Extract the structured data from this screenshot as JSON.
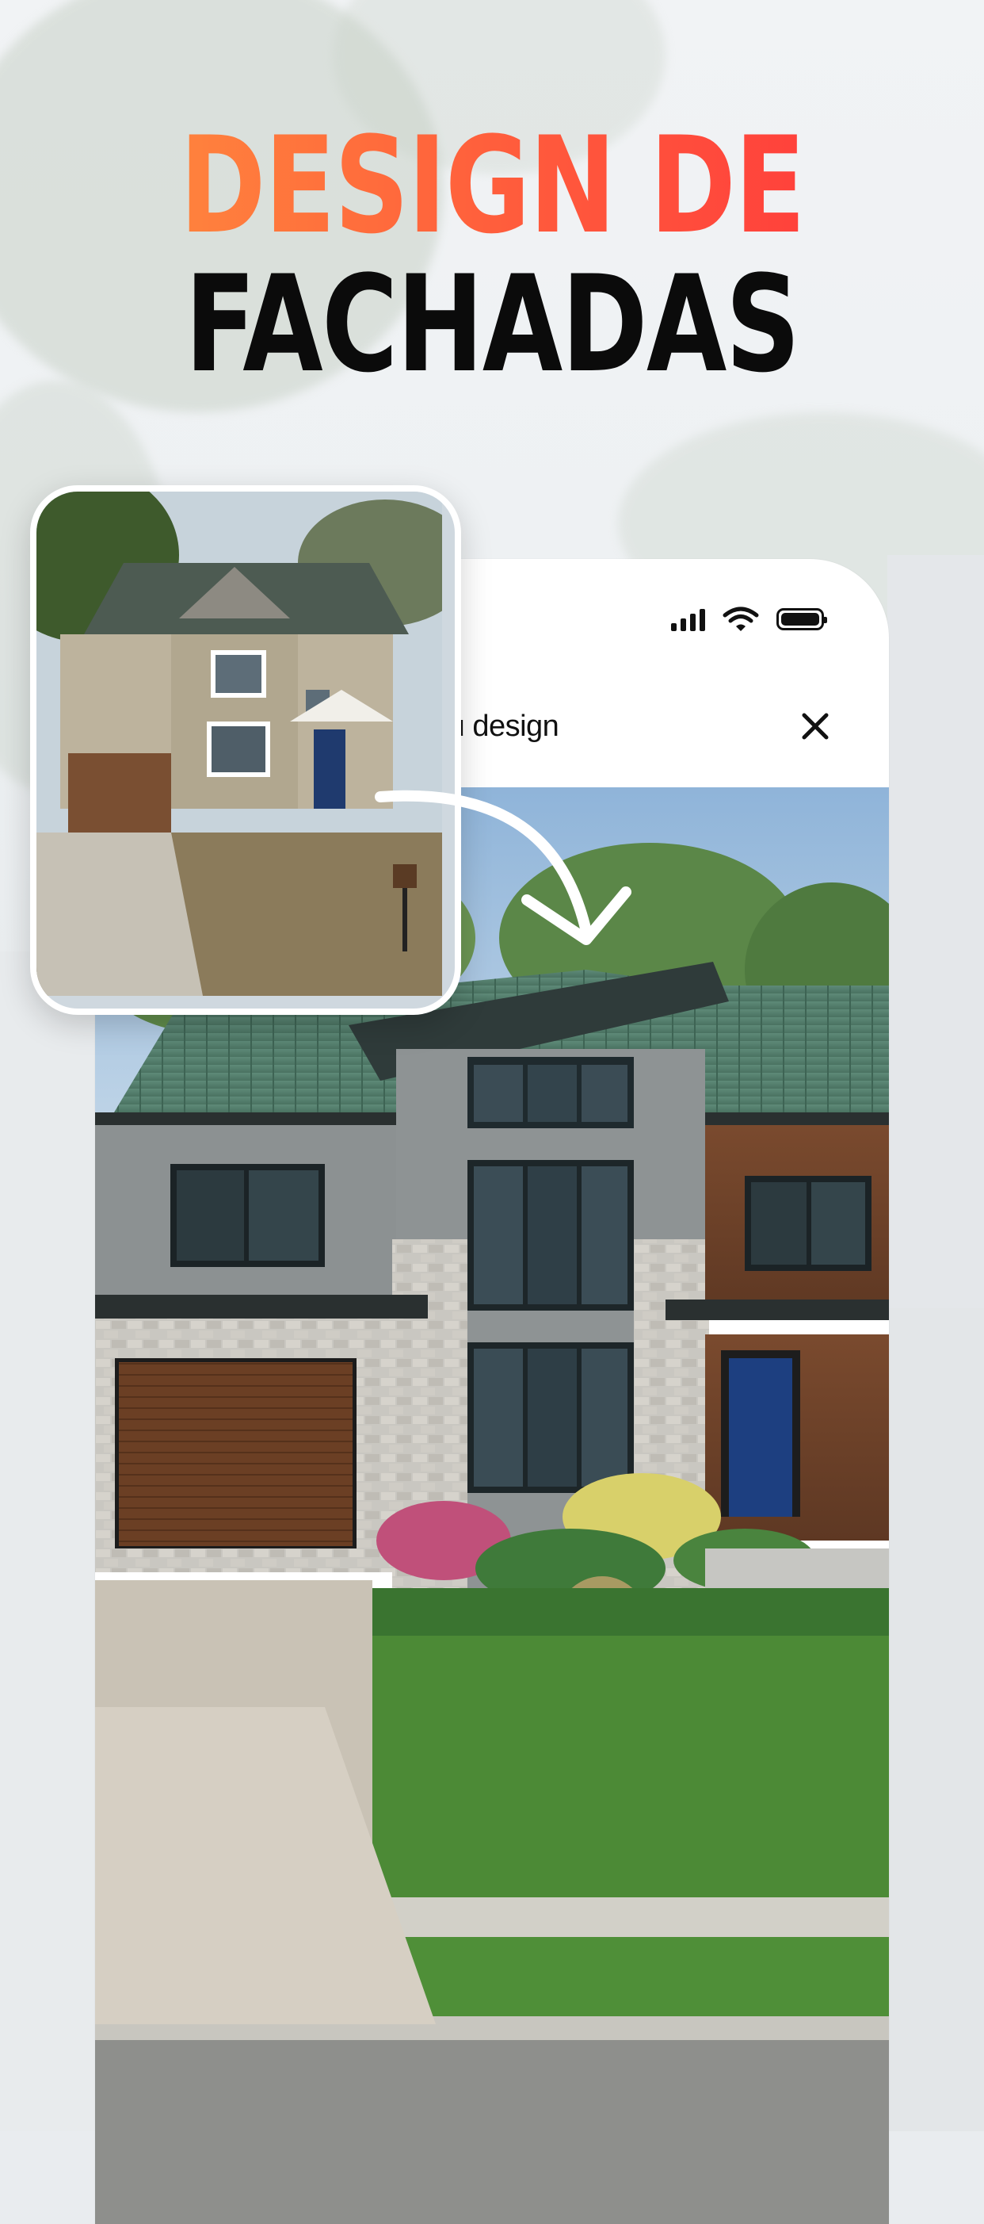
{
  "headline": {
    "line1": "DESIGN DE",
    "line2": "FACHADAS"
  },
  "header": {
    "title": "eu design",
    "close_icon": "close-icon"
  },
  "status_bar": {
    "icons": [
      "cellular-signal-icon",
      "wifi-icon",
      "battery-icon"
    ]
  },
  "colors": {
    "headline_gradient_start": "#ff8a3d",
    "headline_gradient_end": "#ff3b3b",
    "headline_dark": "#0b0b0b"
  },
  "images": {
    "before": "before-house-photo",
    "after": "redesigned-house-photo"
  }
}
